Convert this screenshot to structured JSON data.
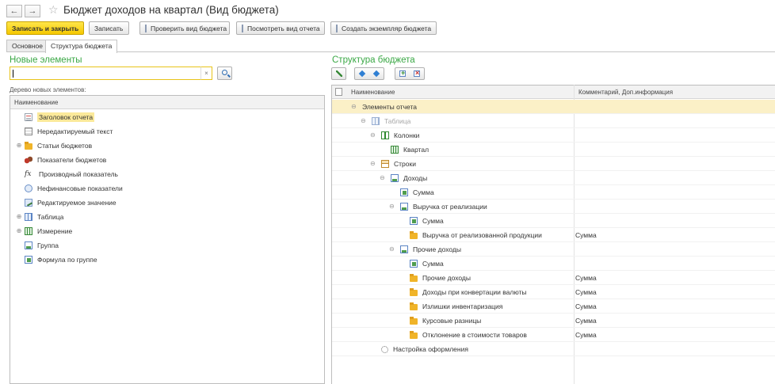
{
  "window": {
    "title": "Бюджет доходов на квартал (Вид бюджета)"
  },
  "toolbar": {
    "save_close": "Записать и закрыть",
    "save": "Записать",
    "check_view": "Проверить вид бюджета",
    "view_report": "Посмотреть вид отчета",
    "create_instance": "Создать экземпляр бюджета"
  },
  "tabs": [
    {
      "label": "Основное",
      "active": false
    },
    {
      "label": "Структура бюджета",
      "active": true
    }
  ],
  "left": {
    "title": "Новые элементы",
    "search_value": "",
    "search_clear": "×",
    "tree_label": "Дерево новых элементов:",
    "column": "Наименование",
    "items": [
      {
        "label": "Заголовок отчета",
        "icon": "report-title-icon",
        "expand": "",
        "highlight": true
      },
      {
        "label": "Нередактируемый текст",
        "icon": "text-icon",
        "expand": "",
        "highlight": false
      },
      {
        "label": "Статьи бюджетов",
        "icon": "folder-icon",
        "expand": "⊕",
        "highlight": false
      },
      {
        "label": "Показатели бюджетов",
        "icon": "coins-icon",
        "expand": "",
        "highlight": false
      },
      {
        "label": "Производный показатель",
        "icon": "fx-icon",
        "expand": "",
        "highlight": false
      },
      {
        "label": "Нефинансовые показатели",
        "icon": "nonfinancial-icon",
        "expand": "",
        "highlight": false
      },
      {
        "label": "Редактируемое значение",
        "icon": "editable-icon",
        "expand": "",
        "highlight": false
      },
      {
        "label": "Таблица",
        "icon": "table-icon",
        "expand": "⊕",
        "highlight": false
      },
      {
        "label": "Измерение",
        "icon": "dimension-icon",
        "expand": "⊕",
        "highlight": false
      },
      {
        "label": "Группа",
        "icon": "group-icon",
        "expand": "",
        "highlight": false
      },
      {
        "label": "Формула по группе",
        "icon": "formula-icon",
        "expand": "",
        "highlight": false
      }
    ]
  },
  "right": {
    "title": "Структура бюджета",
    "columns": {
      "name": "Наименование",
      "comment": "Комментарий, Доп.информация"
    },
    "rows": [
      {
        "label": "Элементы отчета",
        "icon": "",
        "indent": 0,
        "expand": "⊖",
        "comment": "",
        "selected": true,
        "grey": false
      },
      {
        "label": "Таблица",
        "icon": "table-icon",
        "indent": 1,
        "expand": "⊖",
        "comment": "",
        "selected": false,
        "grey": true
      },
      {
        "label": "Колонки",
        "icon": "columns-icon",
        "indent": 2,
        "expand": "⊖",
        "comment": "",
        "selected": false,
        "grey": false
      },
      {
        "label": "Квартал",
        "icon": "dimension-icon",
        "indent": 3,
        "expand": "",
        "comment": "",
        "selected": false,
        "grey": false
      },
      {
        "label": "Строки",
        "icon": "rows-icon",
        "indent": 2,
        "expand": "⊖",
        "comment": "",
        "selected": false,
        "grey": false
      },
      {
        "label": "Доходы",
        "icon": "group-icon",
        "indent": 3,
        "expand": "⊖",
        "comment": "",
        "selected": false,
        "grey": false
      },
      {
        "label": "Сумма",
        "icon": "formula-icon",
        "indent": 4,
        "expand": "",
        "comment": "",
        "selected": false,
        "grey": false
      },
      {
        "label": "Выручка от реализации",
        "icon": "group-icon",
        "indent": 4,
        "expand": "⊖",
        "comment": "",
        "selected": false,
        "grey": false
      },
      {
        "label": "Сумма",
        "icon": "formula-icon",
        "indent": 5,
        "expand": "",
        "comment": "",
        "selected": false,
        "grey": false
      },
      {
        "label": "Выручка от реализованной продукции",
        "icon": "folder-icon",
        "indent": 5,
        "expand": "",
        "comment": "Сумма",
        "selected": false,
        "grey": false
      },
      {
        "label": "Прочие доходы",
        "icon": "group-icon",
        "indent": 4,
        "expand": "⊖",
        "comment": "",
        "selected": false,
        "grey": false
      },
      {
        "label": "Сумма",
        "icon": "formula-icon",
        "indent": 5,
        "expand": "",
        "comment": "",
        "selected": false,
        "grey": false
      },
      {
        "label": "Прочие доходы",
        "icon": "folder-icon",
        "indent": 5,
        "expand": "",
        "comment": "Сумма",
        "selected": false,
        "grey": false
      },
      {
        "label": "Доходы при конвертации валюты",
        "icon": "folder-icon",
        "indent": 5,
        "expand": "",
        "comment": "Сумма",
        "selected": false,
        "grey": false
      },
      {
        "label": "Излишки инвентаризация",
        "icon": "folder-icon",
        "indent": 5,
        "expand": "",
        "comment": "Сумма",
        "selected": false,
        "grey": false
      },
      {
        "label": "Курсовые разницы",
        "icon": "folder-icon",
        "indent": 5,
        "expand": "",
        "comment": "Сумма",
        "selected": false,
        "grey": false
      },
      {
        "label": "Отклонение в стоимости товаров",
        "icon": "folder-icon",
        "indent": 5,
        "expand": "",
        "comment": "Сумма",
        "selected": false,
        "grey": false
      },
      {
        "label": "Настройка оформления",
        "icon": "gear-icon",
        "indent": 2,
        "expand": "",
        "comment": "",
        "selected": false,
        "grey": false
      }
    ]
  }
}
